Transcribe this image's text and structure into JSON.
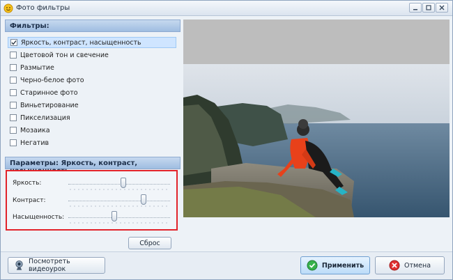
{
  "window": {
    "title": "Фото фильтры"
  },
  "filters_panel": {
    "header": "Фильтры:",
    "items": [
      {
        "label": "Яркость, контраст, насыщенность",
        "checked": true,
        "selected": true
      },
      {
        "label": "Цветовой тон и свечение",
        "checked": false,
        "selected": false
      },
      {
        "label": "Размытие",
        "checked": false,
        "selected": false
      },
      {
        "label": "Черно-белое фото",
        "checked": false,
        "selected": false
      },
      {
        "label": "Старинное фото",
        "checked": false,
        "selected": false
      },
      {
        "label": "Виньетирование",
        "checked": false,
        "selected": false
      },
      {
        "label": "Пикселизация",
        "checked": false,
        "selected": false
      },
      {
        "label": "Мозаика",
        "checked": false,
        "selected": false
      },
      {
        "label": "Негатив",
        "checked": false,
        "selected": false
      }
    ]
  },
  "params_panel": {
    "header": "Параметры: Яркость, контраст, насыщенность",
    "sliders": [
      {
        "label": "Яркость:",
        "value": 0.54
      },
      {
        "label": "Контраст:",
        "value": 0.74
      },
      {
        "label": "Насыщенность:",
        "value": 0.45
      }
    ],
    "reset_label": "Сброс"
  },
  "bottom": {
    "video_label": "Посмотреть видеоурок",
    "apply_label": "Применить",
    "cancel_label": "Отмена"
  },
  "colors": {
    "accent": "#e2232a",
    "selection": "#cfe5ff",
    "header": "#9fbde1",
    "apply_icon": "#37b24d",
    "cancel_icon": "#e03131"
  },
  "icons": {
    "app": "smiley-icon",
    "minimize": "minimize-icon",
    "maximize": "maximize-icon",
    "close": "close-icon",
    "video": "webcam-icon",
    "apply": "checkmark-circle-icon",
    "cancel": "x-circle-icon"
  }
}
